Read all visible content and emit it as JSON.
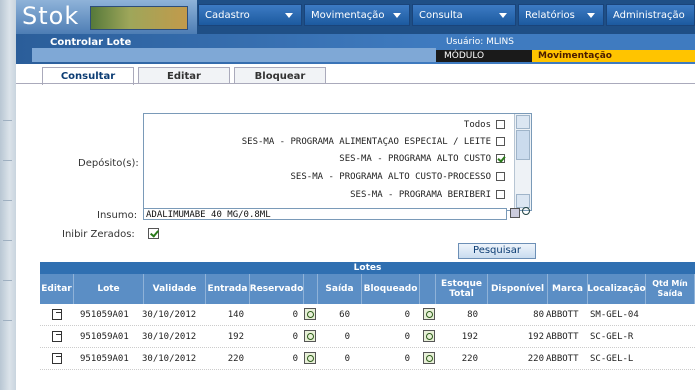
{
  "app": {
    "logo_text": "Stok",
    "menus": [
      "Cadastro",
      "Movimentação",
      "Consulta",
      "Relatórios",
      "Administração"
    ]
  },
  "header": {
    "page_title": "Controlar Lote",
    "usuario_label": "Usuário: MLINS",
    "modulo_label": "MÓDULO",
    "modulo_value": "Movimentação"
  },
  "tabs": [
    "Consultar",
    "Editar",
    "Bloquear"
  ],
  "form": {
    "deposito_label": "Depósito(s):",
    "deposito_options": [
      {
        "label": "Todos",
        "checked": false
      },
      {
        "label": "SES-MA - PROGRAMA ALIMENTAÇAO ESPECIAL / LEITE",
        "checked": false
      },
      {
        "label": "SES-MA - PROGRAMA ALTO CUSTO",
        "checked": true
      },
      {
        "label": "SES-MA - PROGRAMA ALTO CUSTO-PROCESSO",
        "checked": false
      },
      {
        "label": "SES-MA - PROGRAMA BERIBERI",
        "checked": false
      }
    ],
    "insumo_label": "Insumo:",
    "insumo_value": "ADALIMUMABE 40 MG/0.8ML",
    "inibir_label": "Inibir Zerados:",
    "inibir_checked": true,
    "search_button": "Pesquisar"
  },
  "table": {
    "section_title": "Lotes",
    "headers": [
      "Editar",
      "Lote",
      "Validade",
      "Entrada",
      "Reservado",
      "",
      "Saída",
      "Bloqueado",
      "",
      "Estoque Total",
      "Disponível",
      "Marca",
      "Localização",
      "Qtd Mín Saída"
    ],
    "rows": [
      {
        "lote": "951059A01",
        "validade": "30/10/2012",
        "entrada": "140",
        "reservado": "0",
        "saida": "60",
        "bloqueado": "0",
        "estoque": "80",
        "disponivel": "80",
        "marca": "ABBOTT",
        "localizacao": "SM-GEL-04"
      },
      {
        "lote": "951059A01",
        "validade": "30/10/2012",
        "entrada": "192",
        "reservado": "0",
        "saida": "0",
        "bloqueado": "0",
        "estoque": "192",
        "disponivel": "192",
        "marca": "ABBOTT",
        "localizacao": "SC-GEL-R"
      },
      {
        "lote": "951059A01",
        "validade": "30/10/2012",
        "entrada": "220",
        "reservado": "0",
        "saida": "0",
        "bloqueado": "0",
        "estoque": "220",
        "disponivel": "220",
        "marca": "ABBOTT",
        "localizacao": "SC-GEL-L"
      }
    ]
  }
}
